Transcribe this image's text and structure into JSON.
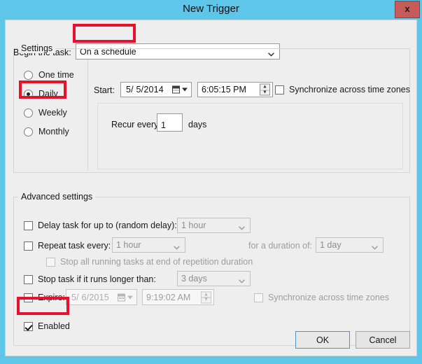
{
  "window": {
    "title": "New Trigger",
    "close_label": "x"
  },
  "begin": {
    "label": "Begin the task:",
    "value": "On a schedule",
    "arrow_icon": "chevron-down-icon"
  },
  "settings": {
    "title": "Settings",
    "schedule_options": [
      {
        "label": "One time",
        "selected": false
      },
      {
        "label": "Daily",
        "selected": true
      },
      {
        "label": "Weekly",
        "selected": false
      },
      {
        "label": "Monthly",
        "selected": false
      }
    ],
    "start_label": "Start:",
    "start_date": "5/  5/2014",
    "start_time": "6:05:15 PM",
    "sync_label": "Synchronize across time zones",
    "sync_checked": false,
    "recur_label": "Recur every:",
    "recur_value": "1",
    "recur_unit": "days"
  },
  "advanced": {
    "title": "Advanced settings",
    "delay_label": "Delay task for up to (random delay):",
    "delay_checked": false,
    "delay_value": "1 hour",
    "repeat_label": "Repeat task every:",
    "repeat_checked": false,
    "repeat_value": "1 hour",
    "duration_label": "for a duration of:",
    "duration_value": "1 day",
    "stop_all_label": "Stop all running tasks at end of repetition duration",
    "stop_all_checked": false,
    "stop_longer_label": "Stop task if it runs longer than:",
    "stop_longer_checked": false,
    "stop_longer_value": "3 days",
    "expire_label": "Expire:",
    "expire_checked": false,
    "expire_date": "5/  6/2015",
    "expire_time": "9:19:02 AM",
    "expire_sync_label": "Synchronize across time zones",
    "expire_sync_checked": false,
    "enabled_label": "Enabled",
    "enabled_checked": true
  },
  "footer": {
    "ok_label": "OK",
    "cancel_label": "Cancel"
  },
  "colors": {
    "titlebar": "#5ec6e8",
    "client": "#efeeee",
    "highlight": "#e8112d",
    "close_button": "#c75b5b"
  }
}
